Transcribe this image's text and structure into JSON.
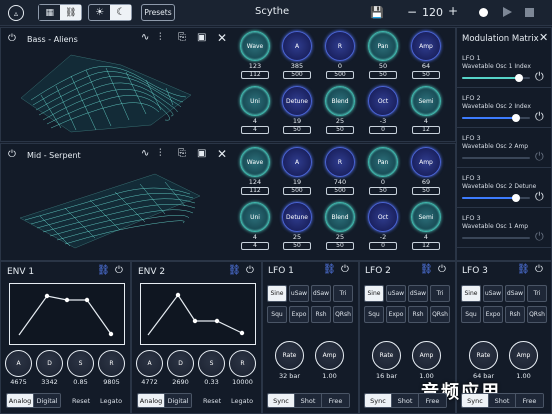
{
  "header": {
    "title": "Scythe",
    "presets_label": "Presets",
    "tempo": "120",
    "minus": "−",
    "plus": "+"
  },
  "oscillators": [
    {
      "name": "Bass - Aliens",
      "knobs_row1": [
        {
          "label": "Wave",
          "value": "123",
          "box": "112"
        },
        {
          "label": "A",
          "value": "385",
          "box": "500"
        },
        {
          "label": "R",
          "value": "0",
          "box": "500"
        },
        {
          "label": "Pan",
          "value": "50",
          "box": "50"
        },
        {
          "label": "Amp",
          "value": "64",
          "box": "50"
        }
      ],
      "knobs_row2": [
        {
          "label": "Uni",
          "value": "4",
          "box": "4"
        },
        {
          "label": "Detune",
          "value": "19",
          "box": "50"
        },
        {
          "label": "Blend",
          "value": "25",
          "box": "50"
        },
        {
          "label": "Oct",
          "value": "-3",
          "box": "0"
        },
        {
          "label": "Semi",
          "value": "4",
          "box": "12"
        }
      ]
    },
    {
      "name": "Mid - Serpent",
      "knobs_row1": [
        {
          "label": "Wave",
          "value": "124",
          "box": "112"
        },
        {
          "label": "A",
          "value": "19",
          "box": "500"
        },
        {
          "label": "R",
          "value": "740",
          "box": "500"
        },
        {
          "label": "Pan",
          "value": "0",
          "box": "50"
        },
        {
          "label": "Amp",
          "value": "69",
          "box": "50"
        }
      ],
      "knobs_row2": [
        {
          "label": "Uni",
          "value": "4",
          "box": "4"
        },
        {
          "label": "Detune",
          "value": "25",
          "box": "50"
        },
        {
          "label": "Blend",
          "value": "25",
          "box": "50"
        },
        {
          "label": "Oct",
          "value": "-2",
          "box": "0"
        },
        {
          "label": "Semi",
          "value": "4",
          "box": "12"
        }
      ]
    }
  ],
  "modulation": {
    "title": "Modulation Matrix",
    "items": [
      {
        "source": "LFO 1",
        "target": "Wavetable Osc 1 Index",
        "amount": 0.84,
        "active": true
      },
      {
        "source": "LFO 2",
        "target": "Wavetable Osc 2 Index",
        "amount": 0.8,
        "active": true
      },
      {
        "source": "LFO 3",
        "target": "Wavetable Osc 2 Amp",
        "amount": 0,
        "active": false
      },
      {
        "source": "LFO 3",
        "target": "Wavetable Osc 2 Detune",
        "amount": 0.8,
        "active": true
      },
      {
        "source": "LFO 3",
        "target": "Wavetable Osc 1 Amp",
        "amount": 0,
        "active": false
      }
    ]
  },
  "envelopes": [
    {
      "name": "ENV 1",
      "knobs": [
        {
          "label": "A",
          "value": "4675"
        },
        {
          "label": "D",
          "value": "3342"
        },
        {
          "label": "S",
          "value": "0.85"
        },
        {
          "label": "R",
          "value": "9805"
        }
      ],
      "mode_analog": "Analog",
      "mode_digital": "Digital",
      "reset": "Reset",
      "legato": "Legato"
    },
    {
      "name": "ENV 2",
      "knobs": [
        {
          "label": "A",
          "value": "4772"
        },
        {
          "label": "D",
          "value": "2690"
        },
        {
          "label": "S",
          "value": "0.33"
        },
        {
          "label": "R",
          "value": "10000"
        }
      ],
      "mode_analog": "Analog",
      "mode_digital": "Digital",
      "reset": "Reset",
      "legato": "Legato"
    }
  ],
  "lfos": [
    {
      "name": "LFO 1",
      "rate": "32 bar",
      "amp": "1.00"
    },
    {
      "name": "LFO 2",
      "rate": "16 bar",
      "amp": "1.00"
    },
    {
      "name": "LFO 3",
      "rate": "64 bar",
      "amp": "1.00"
    }
  ],
  "lfo_shapes": [
    "Sine",
    "uSaw",
    "dSaw",
    "Tri",
    "Squ",
    "Expo",
    "Rsh",
    "QRsh"
  ],
  "lfo_labels": {
    "rate": "Rate",
    "amp": "Amp",
    "sync": "Sync",
    "shot": "Shot",
    "free": "Free"
  },
  "watermark": "音频应用",
  "colors": {
    "accent_teal": "#56d3c8",
    "accent_blue": "#4a64d4",
    "bg": "#161e2c"
  }
}
